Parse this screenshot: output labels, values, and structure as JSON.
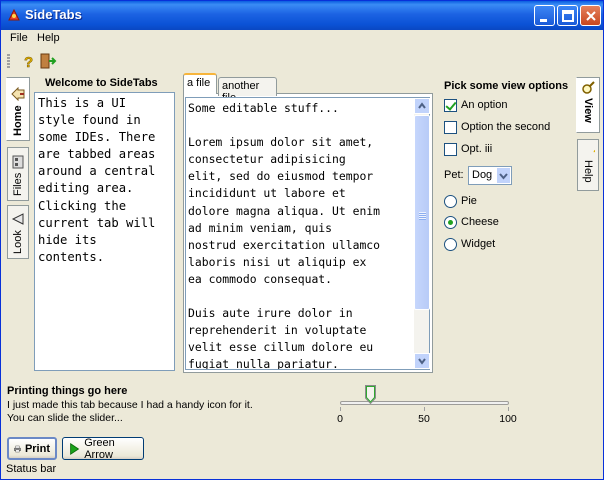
{
  "window": {
    "title": "SideTabs"
  },
  "menu": {
    "file": "File",
    "help": "Help"
  },
  "left_tabs": [
    {
      "label": "Home",
      "active": true
    },
    {
      "label": "Files",
      "active": false
    },
    {
      "label": "Look",
      "active": false
    }
  ],
  "welcome": {
    "title": "Welcome to SideTabs",
    "text": "This is a UI\nstyle found in\nsome IDEs. There\nare tabbed areas\naround a central\nediting area.\nClicking the\ncurrent tab will\nhide its\ncontents."
  },
  "editor": {
    "tabs": [
      {
        "label": "a file",
        "active": true
      },
      {
        "label": "another file",
        "active": false
      }
    ],
    "text": "Some editable stuff...\n\nLorem ipsum dolor sit amet,\nconsectetur adipisicing\nelit, sed do eiusmod tempor\nincididunt ut labore et\ndolore magna aliqua. Ut enim\nad minim veniam, quis\nnostrud exercitation ullamco\nlaboris nisi ut aliquip ex\nea commodo consequat.\n\nDuis aute irure dolor in\nreprehenderit in voluptate\nvelit esse cillum dolore eu\nfugiat nulla pariatur."
  },
  "view_options": {
    "title": "Pick some view options",
    "checks": [
      {
        "label": "An option",
        "checked": true
      },
      {
        "label": "Option the second",
        "checked": false
      },
      {
        "label": "Opt. iii",
        "checked": false
      }
    ],
    "pet_label": "Pet:",
    "pet_value": "Dog",
    "radios": [
      {
        "label": "Pie",
        "selected": false
      },
      {
        "label": "Cheese",
        "selected": true
      },
      {
        "label": "Widget",
        "selected": false
      }
    ]
  },
  "right_tabs": [
    {
      "label": "View",
      "active": true
    },
    {
      "label": "Help",
      "active": false
    }
  ],
  "printing": {
    "title": "Printing things go here",
    "line1": "I just made this tab because I had a handy icon for it.",
    "line2": "You can slide the slider..."
  },
  "slider": {
    "min": 0,
    "max": 100,
    "value": 18,
    "ticks": [
      "0",
      "50",
      "100"
    ]
  },
  "buttons": {
    "print": "Print",
    "green_arrow": "Green Arrow"
  },
  "status": "Status bar",
  "colors": {
    "title_bar": "#0a5de0",
    "window_bg": "#ece9d8",
    "check_mark": "#21a121"
  },
  "icons": [
    "app-icon",
    "help-question-icon",
    "exit-door-icon",
    "home-icon",
    "files-icon",
    "look-icon",
    "view-icon",
    "help-icon",
    "printer-icon",
    "green-arrow-icon"
  ]
}
